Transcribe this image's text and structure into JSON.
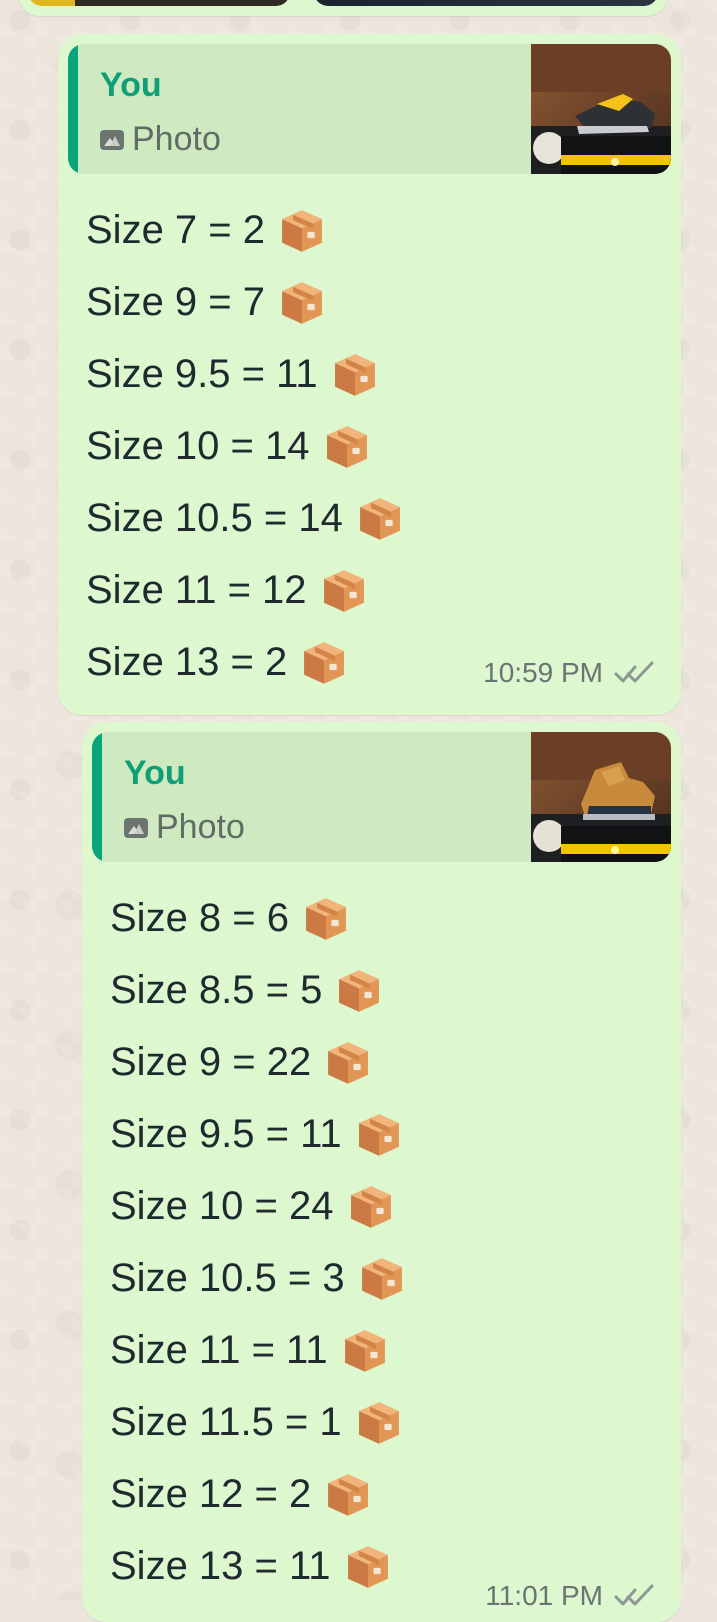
{
  "conversation": {
    "messages": [
      {
        "quote": {
          "sender": "You",
          "type": "Photo",
          "thumbnail_subject": "black and yellow work shoe on a box"
        },
        "lines": [
          "Size 7 = 2",
          "Size 9 = 7",
          "Size 9.5 = 11",
          "Size 10 = 14",
          "Size 10.5 = 14",
          "Size 11 = 12",
          "Size 13 = 2"
        ],
        "time": "10:59 PM",
        "status_icon": "double-check-icon"
      },
      {
        "quote": {
          "sender": "You",
          "type": "Photo",
          "thumbnail_subject": "tan and navy work boot on a box"
        },
        "lines": [
          "Size 8 = 6",
          "Size 8.5 = 5",
          "Size 9 = 22",
          "Size 9.5 = 11",
          "Size 10 = 24",
          "Size 10.5 = 3",
          "Size 11 = 11",
          "Size 11.5 = 1",
          "Size 12 = 2",
          "Size 13 = 11"
        ],
        "time": "11:01 PM",
        "status_icon": "double-check-icon"
      }
    ]
  },
  "colors": {
    "chat_background": "#ede5dc",
    "bubble": "#ddf7cf",
    "quote_bar": "#08a57b",
    "sender": "#129e76"
  }
}
